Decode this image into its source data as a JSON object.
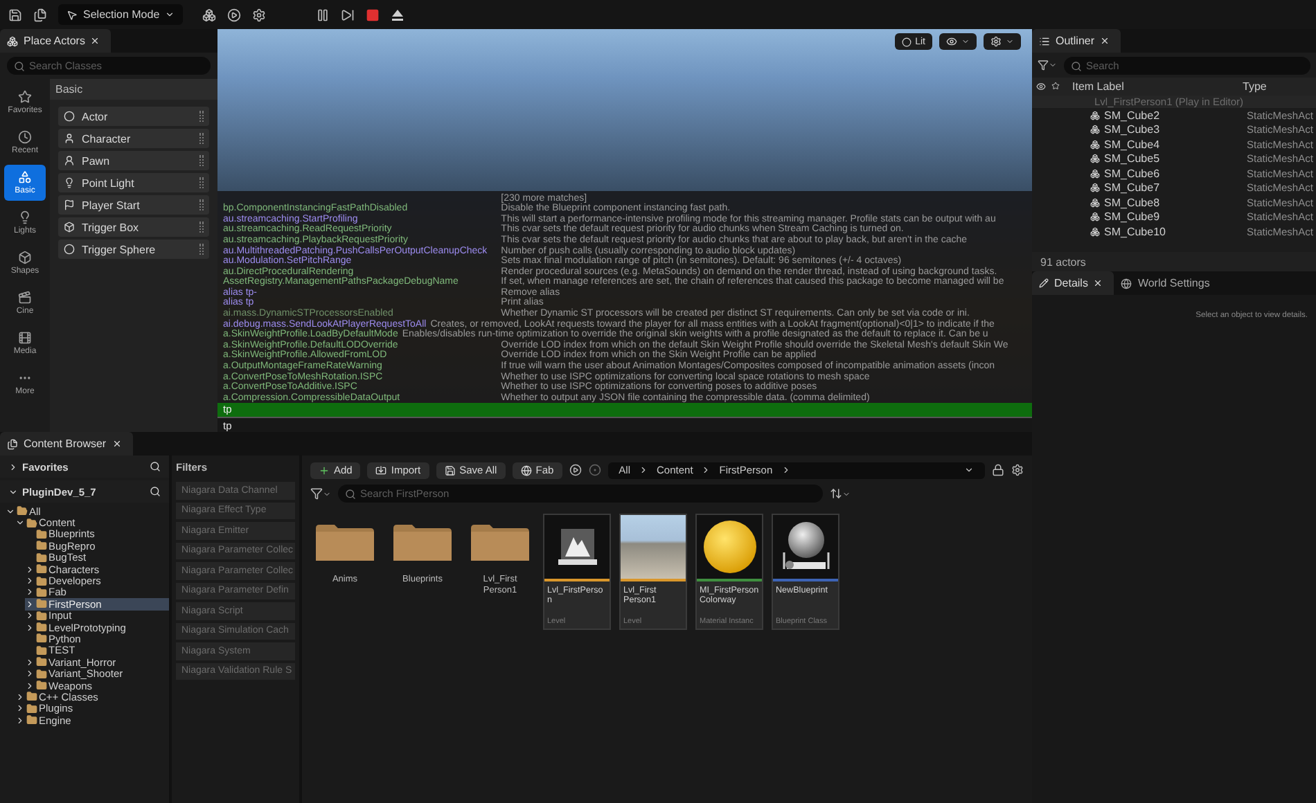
{
  "toolbar": {
    "mode": "Selection Mode"
  },
  "place_actors": {
    "tab": "Place Actors",
    "search": {
      "placeholder": "Search Classes"
    },
    "categories": [
      {
        "label": "Favorites",
        "selected": false
      },
      {
        "label": "Recent",
        "selected": false
      },
      {
        "label": "Basic",
        "selected": true
      },
      {
        "label": "Lights",
        "selected": false
      },
      {
        "label": "Shapes",
        "selected": false
      },
      {
        "label": "Cine",
        "selected": false
      },
      {
        "label": "Media",
        "selected": false
      },
      {
        "label": "More",
        "selected": false
      }
    ],
    "section": "Basic",
    "items": [
      "Actor",
      "Character",
      "Pawn",
      "Point Light",
      "Player Start",
      "Trigger Box",
      "Trigger Sphere"
    ]
  },
  "viewport": {
    "view_mode": "Lit"
  },
  "console": {
    "more_matches": "[230 more matches]",
    "lines": [
      {
        "command": "bp.ComponentInstancingFastPathDisabled",
        "description": "Disable the Blueprint component instancing fast path.",
        "kind": "variable",
        "inline": false
      },
      {
        "command": "au.streamcaching.StartProfiling",
        "description": "This will start a performance-intensive profiling mode for this streaming manager. Profile stats can be output with au",
        "kind": "command",
        "inline": false
      },
      {
        "command": "au.streamcaching.ReadRequestPriority",
        "description": "This cvar sets the default request priority for audio chunks when Stream Caching is turned on.",
        "kind": "variable",
        "inline": false
      },
      {
        "command": "au.streamcaching.PlaybackRequestPriority",
        "description": "This cvar sets the default request priority for audio chunks that are about to play back, but aren't in the cache",
        "kind": "variable",
        "inline": false
      },
      {
        "command": "au.MultithreadedPatching.PushCallsPerOutputCleanupCheck",
        "description": "Number of push calls (usually corresponding to audio block updates)",
        "kind": "command",
        "inline": false
      },
      {
        "command": "au.Modulation.SetPitchRange",
        "description": "Sets max final modulation range of pitch (in semitones). Default: 96 semitones (+/- 4 octaves)",
        "kind": "command",
        "inline": false
      },
      {
        "command": "au.DirectProceduralRendering",
        "description": "Render procedural sources (e.g. MetaSounds) on demand on the render thread, instead of using background tasks.",
        "kind": "variable",
        "inline": false
      },
      {
        "command": "AssetRegistry.ManagementPathsPackageDebugName",
        "description": "If set, when manage references are set, the chain of references that caused this package to become managed will be",
        "kind": "variable",
        "inline": false
      },
      {
        "command": "alias tp-",
        "description": "Remove alias",
        "kind": "command",
        "inline": false
      },
      {
        "command": "alias tp",
        "description": "Print alias",
        "kind": "command",
        "inline": false
      },
      {
        "command": "ai.mass.DynamicSTProcessorsEnabled",
        "description": "Whether Dynamic ST processors will be created per distinct ST requirements. Can only be set via code or ini.",
        "kind": "inactive",
        "inline": false
      },
      {
        "command": "ai.debug.mass.SendLookAtPlayerRequestToAll",
        "description": "Creates, or removed, LookAt requests toward the player for all mass entities with a LookAt fragment(optional)<0|1> to indicate if the",
        "kind": "command",
        "inline": true
      },
      {
        "command": "a.SkinWeightProfile.LoadByDefaultMode",
        "description": "Enables/disables run-time optimization to override the original skin weights with a profile designated as the default to replace it. Can be u",
        "kind": "variable",
        "inline": true
      },
      {
        "command": "a.SkinWeightProfile.DefaultLODOverride",
        "description": "Override LOD index from which on the default Skin Weight Profile should override the Skeletal Mesh's default Skin We",
        "kind": "variable",
        "inline": false
      },
      {
        "command": "a.SkinWeightProfile.AllowedFromLOD",
        "description": "Override LOD index from which on the Skin Weight Profile can be applied",
        "kind": "variable",
        "inline": false
      },
      {
        "command": "a.OutputMontageFrameRateWarning",
        "description": "If true will warn the user about Animation Montages/Composites composed of incompatible animation assets (incon",
        "kind": "variable",
        "inline": false
      },
      {
        "command": "a.ConvertPoseToMeshRotation.ISPC",
        "description": "Whether to use ISPC optimizations for converting local space rotations to mesh space",
        "kind": "variable",
        "inline": false
      },
      {
        "command": "a.ConvertPoseToAdditive.ISPC",
        "description": "Whether to use ISPC optimizations for converting poses to additive poses",
        "kind": "variable",
        "inline": false
      },
      {
        "command": "a.Compression.CompressibleDataOutput",
        "description": "Whether to output any JSON file containing the compressible data. (comma delimited)",
        "kind": "variable",
        "inline": false
      }
    ],
    "suggestion": {
      "text": "tp",
      "selected": true
    },
    "input": {
      "value": "tp"
    }
  },
  "outliner": {
    "tab": "Outliner",
    "search": {
      "placeholder": "Search"
    },
    "columns": [
      "Item Label",
      "Type"
    ],
    "world": "Lvl_FirstPerson1 (Play in Editor)",
    "rows": [
      {
        "label": "SM_Cube2",
        "type": "StaticMeshAct"
      },
      {
        "label": "SM_Cube3",
        "type": "StaticMeshAct"
      },
      {
        "label": "SM_Cube4",
        "type": "StaticMeshAct"
      },
      {
        "label": "SM_Cube5",
        "type": "StaticMeshAct"
      },
      {
        "label": "SM_Cube6",
        "type": "StaticMeshAct"
      },
      {
        "label": "SM_Cube7",
        "type": "StaticMeshAct"
      },
      {
        "label": "SM_Cube8",
        "type": "StaticMeshAct"
      },
      {
        "label": "SM_Cube9",
        "type": "StaticMeshAct"
      },
      {
        "label": "SM_Cube10",
        "type": "StaticMeshAct"
      }
    ],
    "count": "91 actors"
  },
  "details": {
    "tabs": [
      {
        "label": "Details",
        "selected": true
      },
      {
        "label": "World Settings",
        "selected": false
      }
    ],
    "empty_message": "Select an object to view details."
  },
  "content_browser": {
    "tab": "Content Browser",
    "sources": [
      {
        "label": "Favorites",
        "expanded": false
      },
      {
        "label": "PluginDev_5_7",
        "expanded": true
      }
    ],
    "tree": [
      {
        "label": "All",
        "expandable": true,
        "expanded": true,
        "selected": false,
        "children": [
          {
            "label": "Content",
            "expandable": true,
            "expanded": true,
            "selected": false,
            "children": [
              {
                "label": "Blueprints",
                "expandable": false,
                "expanded": false,
                "selected": false
              },
              {
                "label": "BugRepro",
                "expandable": false,
                "expanded": false,
                "selected": false
              },
              {
                "label": "BugTest",
                "expandable": false,
                "expanded": false,
                "selected": false
              },
              {
                "label": "Characters",
                "expandable": true,
                "expanded": false,
                "selected": false
              },
              {
                "label": "Developers",
                "expandable": true,
                "expanded": false,
                "selected": false
              },
              {
                "label": "Fab",
                "expandable": true,
                "expanded": false,
                "selected": false
              },
              {
                "label": "FirstPerson",
                "expandable": true,
                "expanded": false,
                "selected": true
              },
              {
                "label": "Input",
                "expandable": true,
                "expanded": false,
                "selected": false
              },
              {
                "label": "LevelPrototyping",
                "expandable": true,
                "expanded": false,
                "selected": false
              },
              {
                "label": "Python",
                "expandable": false,
                "expanded": false,
                "selected": false
              },
              {
                "label": "TEST",
                "expandable": false,
                "expanded": false,
                "selected": false
              },
              {
                "label": "Variant_Horror",
                "expandable": true,
                "expanded": false,
                "selected": false
              },
              {
                "label": "Variant_Shooter",
                "expandable": true,
                "expanded": false,
                "selected": false
              },
              {
                "label": "Weapons",
                "expandable": true,
                "expanded": false,
                "selected": false
              }
            ]
          },
          {
            "label": "C++ Classes",
            "expandable": true,
            "expanded": false,
            "selected": false
          },
          {
            "label": "Plugins",
            "expandable": true,
            "expanded": false,
            "selected": false
          },
          {
            "label": "Engine",
            "expandable": true,
            "expanded": false,
            "selected": false
          }
        ]
      }
    ],
    "filters_title": "Filters",
    "filters": [
      "Niagara Data Channel",
      "Niagara Effect Type",
      "Niagara Emitter",
      "Niagara Parameter Collec",
      "Niagara Parameter Collec",
      "Niagara Parameter Defin",
      "Niagara Script",
      "Niagara Simulation Cach",
      "Niagara System",
      "Niagara Validation Rule S"
    ],
    "buttons": [
      "Add",
      "Import",
      "Save All",
      "Fab"
    ],
    "path": [
      "All",
      "Content",
      "FirstPerson"
    ],
    "search": {
      "placeholder": "Search FirstPerson"
    },
    "assets": [
      {
        "kind": "folder",
        "name": "Anims"
      },
      {
        "kind": "folder",
        "name": "Blueprints"
      },
      {
        "kind": "folder",
        "name": "Lvl_First Person1"
      },
      {
        "kind": "level",
        "name": "Lvl_FirstPerson",
        "type": "Level",
        "color": "#d9962b"
      },
      {
        "kind": "level-preview",
        "name": "Lvl_First Person1",
        "type": "Level",
        "color": "#d9962b"
      },
      {
        "kind": "material",
        "name": "MI_FirstPerson Colorway",
        "type": "Material Instanc",
        "color": "#3f8f3f"
      },
      {
        "kind": "blueprint",
        "name": "NewBlueprint",
        "type": "Blueprint Class",
        "color": "#3d63b5"
      }
    ]
  }
}
